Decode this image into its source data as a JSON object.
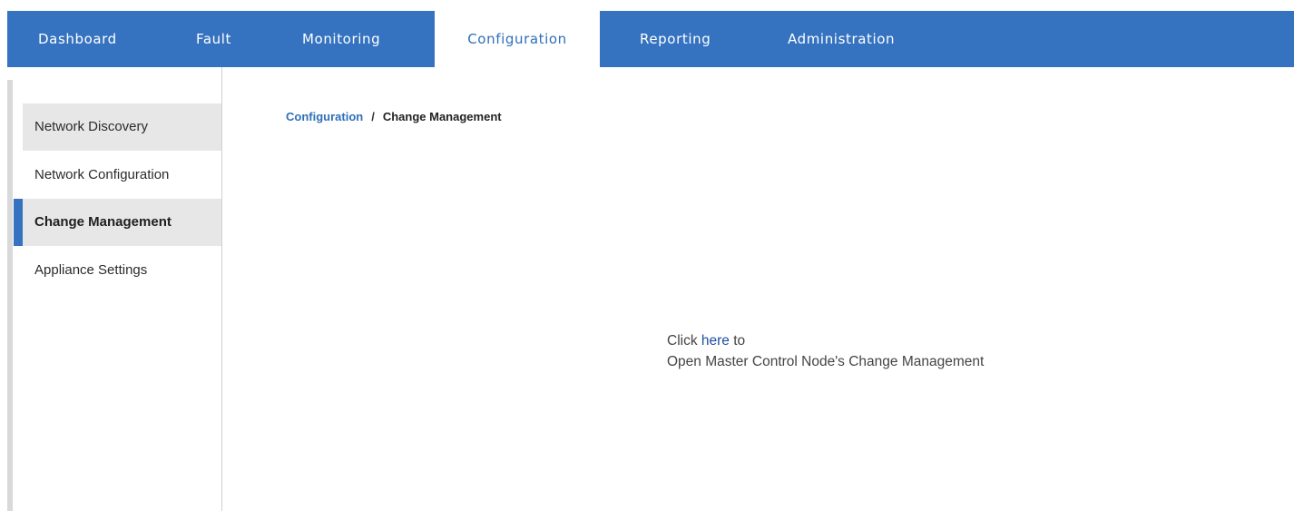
{
  "colors": {
    "nav_background": "#3573c0",
    "nav_active_text": "#2f6fb8",
    "sidebar_active_marker": "#3573c0",
    "link": "#2f6fb8"
  },
  "nav": {
    "tabs": [
      {
        "label": "Dashboard",
        "active": false
      },
      {
        "label": "Fault",
        "active": false
      },
      {
        "label": "Monitoring",
        "active": false
      },
      {
        "label": "Configuration",
        "active": true
      },
      {
        "label": "Reporting",
        "active": false
      },
      {
        "label": "Administration",
        "active": false
      }
    ]
  },
  "sidebar": {
    "items": [
      {
        "label": "Network Discovery",
        "active": false
      },
      {
        "label": "Network Configuration",
        "active": false
      },
      {
        "label": "Change Management",
        "active": true
      },
      {
        "label": "Appliance Settings",
        "active": false
      }
    ]
  },
  "breadcrumb": {
    "parent": "Configuration",
    "separator": "/",
    "current": "Change Management"
  },
  "main": {
    "click_prefix": "Click",
    "link_text": "here",
    "click_suffix": "to",
    "description": "Open Master Control Node's Change Management"
  }
}
